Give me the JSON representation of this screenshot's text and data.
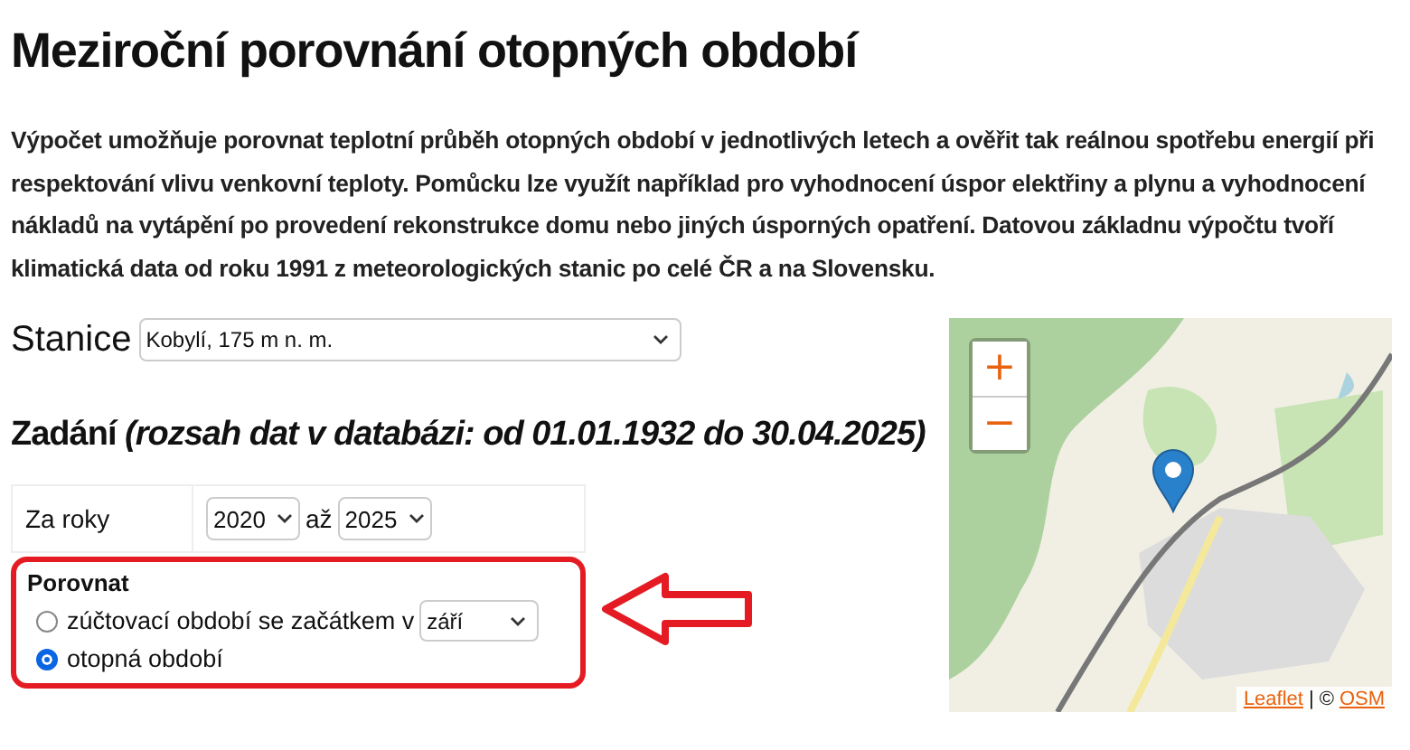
{
  "title": "Meziroční porovnání otopných období",
  "intro": "Výpočet umožňuje porovnat teplotní průběh otopných období v jednotlivých letech a ověřit tak reálnou spotřebu energií při respektování vlivu venkovní teploty. Pomůcku lze využít například pro vyhodnocení úspor elektřiny a plynu a vyhodnocení nákladů na vytápění po provedení rekonstrukce domu nebo jiných úsporných opatření. Datovou základnu výpočtu tvoří klimatická data od roku 1991 z meteorologických stanic po celé ČR a na Slovensku.",
  "station": {
    "label": "Stanice",
    "value": "Kobylí, 175 m n. m."
  },
  "section_heading": "Zadání *(rozsah dat v databázi: od 01.01.1932 do 30.04.2025)*",
  "years": {
    "label": "Za roky",
    "from": "2020",
    "separator": "až",
    "to": "2025"
  },
  "compare": {
    "label": "Porovnat",
    "highlighted": true,
    "options": [
      {
        "label": "zúčtovací období se začátkem v",
        "selected": false,
        "month": "září"
      },
      {
        "label": "otopná období",
        "selected": true
      }
    ]
  },
  "map": {
    "zoom_in": "+",
    "zoom_out": "−",
    "attribution": [
      {
        "text": "Leaflet",
        "kind": "link"
      },
      {
        "text": "|",
        "kind": "text"
      },
      {
        "text": "©",
        "kind": "text"
      },
      {
        "text": "OSM",
        "kind": "link"
      }
    ]
  }
}
